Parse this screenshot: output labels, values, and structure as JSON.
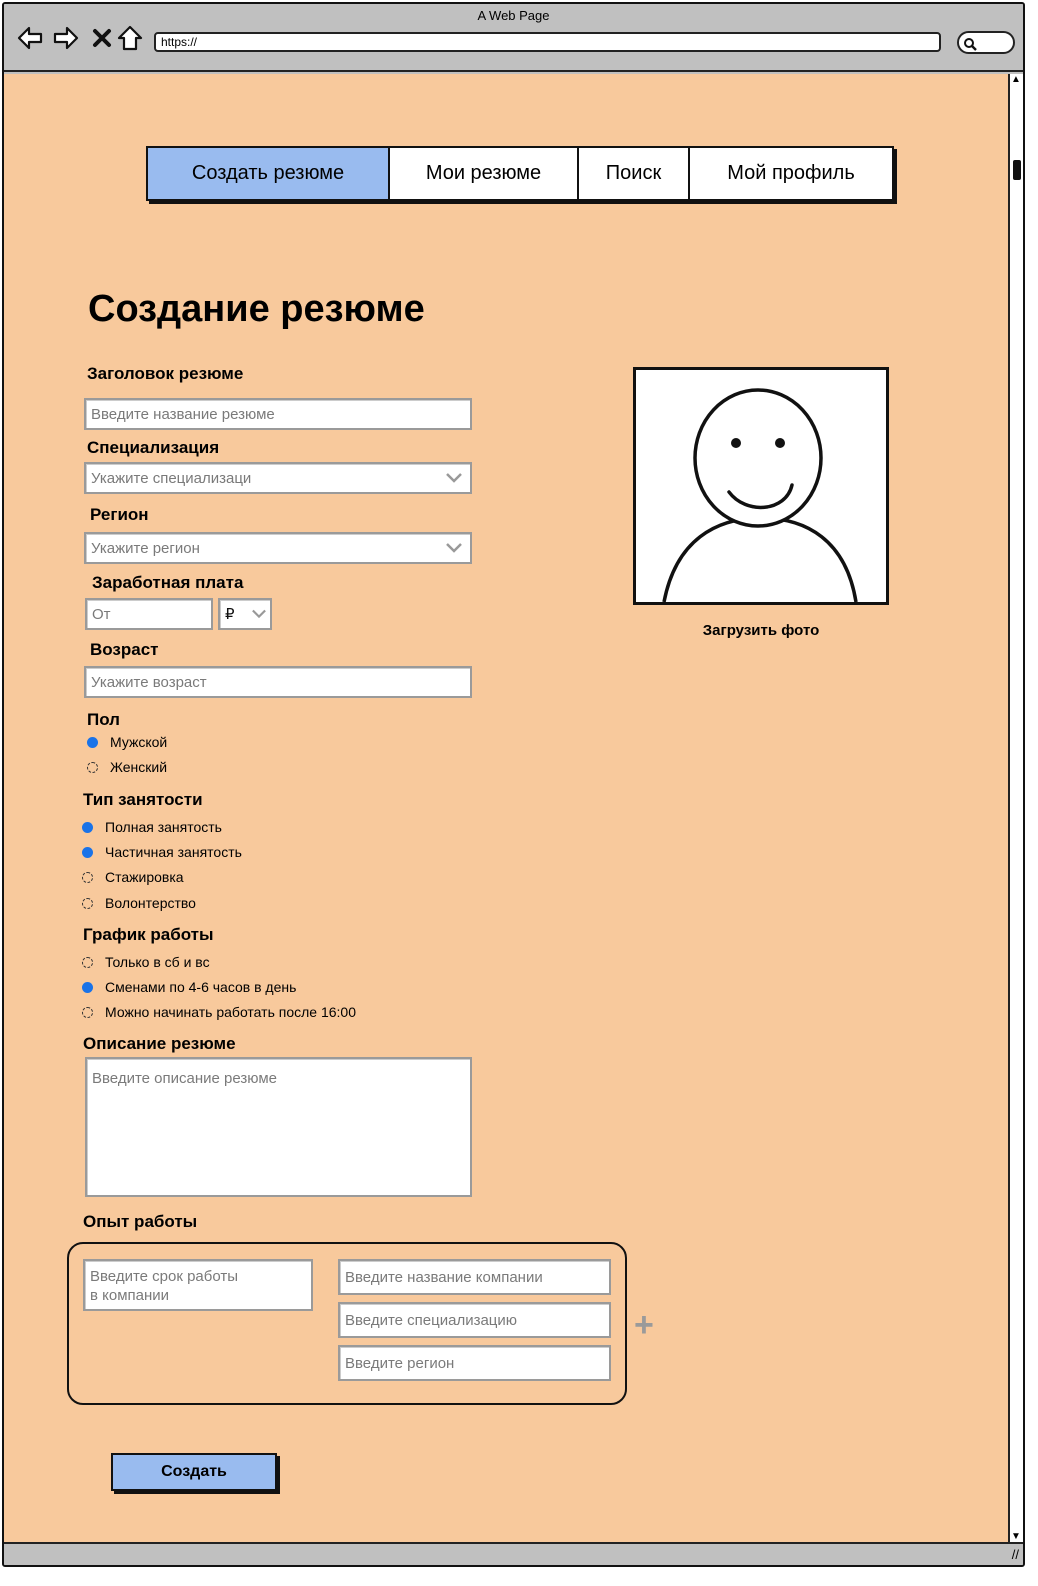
{
  "window": {
    "title": "A Web Page",
    "url": "https://"
  },
  "nav_tabs": [
    {
      "label": "Создать резюме",
      "active": true
    },
    {
      "label": "Мои резюме",
      "active": false
    },
    {
      "label": "Поиск",
      "active": false
    },
    {
      "label": "Мой профиль",
      "active": false
    }
  ],
  "form": {
    "title": "Создание резюме",
    "resume_title": {
      "label": "Заголовок резюме",
      "placeholder": "Введите название резюме"
    },
    "specialization": {
      "label": "Специализация",
      "placeholder": "Укажите специализаци"
    },
    "region": {
      "label": "Регион",
      "placeholder": "Укажите регион"
    },
    "salary": {
      "label": "Заработная плата",
      "placeholder": "От",
      "currency": "₽"
    },
    "age": {
      "label": "Возраст",
      "placeholder": "Укажите возраст"
    },
    "gender": {
      "label": "Пол",
      "options": [
        {
          "label": "Мужской",
          "selected": true
        },
        {
          "label": "Женский",
          "selected": false
        }
      ]
    },
    "employment": {
      "label": "Тип занятости",
      "options": [
        {
          "label": "Полная занятость",
          "selected": true
        },
        {
          "label": "Частичная занятость",
          "selected": true
        },
        {
          "label": "Стажировка",
          "selected": false
        },
        {
          "label": "Волонтерство",
          "selected": false
        }
      ]
    },
    "schedule": {
      "label": "График работы",
      "options": [
        {
          "label": "Только в сб и вс",
          "selected": false
        },
        {
          "label": "Сменами по 4-6 часов в день",
          "selected": true
        },
        {
          "label": "Можно начинать работать после 16:00",
          "selected": false
        }
      ]
    },
    "description": {
      "label": "Описание резюме",
      "placeholder": "Введите описание резюме"
    },
    "experience": {
      "label": "Опыт работы",
      "duration_placeholder": "Введите срок работы\nв компании",
      "company_placeholder": "Введите название компании",
      "specialization_placeholder": "Введите специализацию",
      "region_placeholder": "Введите регион",
      "add_symbol": "+"
    },
    "submit_label": "Создать"
  },
  "photo": {
    "upload_label": "Загрузить фото"
  },
  "colors": {
    "background": "#f8c99c",
    "accent": "#99bbef",
    "radio_on": "#1a73e8"
  }
}
